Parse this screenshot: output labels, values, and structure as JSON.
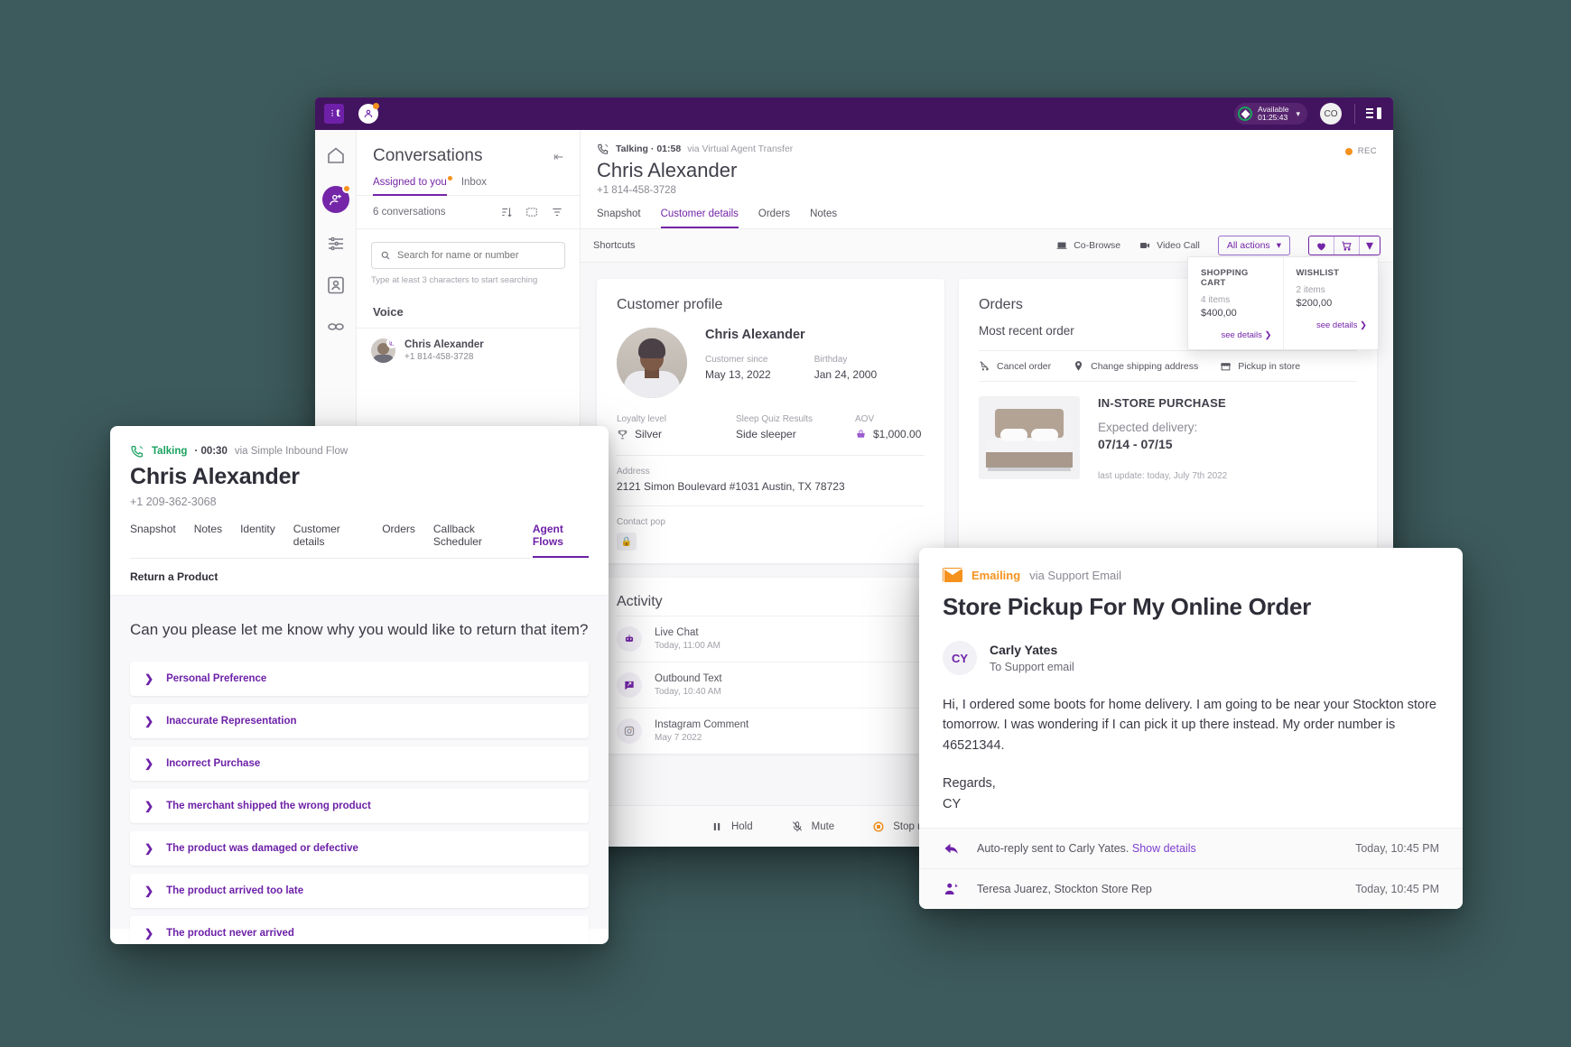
{
  "app": {
    "logo_letter": "t",
    "status": {
      "label": "Available",
      "timer": "01:25:43"
    },
    "user_initials": "CO"
  },
  "conversations": {
    "title": "Conversations",
    "tabs": [
      {
        "label": "Assigned to you",
        "active": true,
        "dot": true
      },
      {
        "label": "Inbox",
        "active": false,
        "dot": false
      }
    ],
    "count_label": "6 conversations",
    "search": {
      "placeholder": "Search for name or number",
      "value": ""
    },
    "search_hint": "Type at least 3 characters to start searching",
    "section_label": "Voice",
    "items": [
      {
        "name": "Chris Alexander",
        "number": "+1 814-458-3728"
      }
    ]
  },
  "main": {
    "status_label": "Talking",
    "duration": "01:58",
    "via": "via Virtual Agent Transfer",
    "customer_name": "Chris Alexander",
    "customer_number": "+1 814-458-3728",
    "rec_label": "REC",
    "tabs": [
      {
        "label": "Snapshot",
        "active": false
      },
      {
        "label": "Customer details",
        "active": true
      },
      {
        "label": "Orders",
        "active": false
      },
      {
        "label": "Notes",
        "active": false
      }
    ],
    "shortcuts_label": "Shortcuts",
    "shortcut_actions": [
      {
        "label": "Co-Browse",
        "icon": "co-browse-icon"
      },
      {
        "label": "Video Call",
        "icon": "video-call-icon"
      }
    ],
    "all_actions_label": "All actions",
    "cart_dropdown": [
      {
        "title": "SHOPPING CART",
        "items": "4 items",
        "amount": "$400,00",
        "link": "see details"
      },
      {
        "title": "WISHLIST",
        "items": "2 items",
        "amount": "$200,00",
        "link": "see details"
      }
    ]
  },
  "profile": {
    "card_title": "Customer profile",
    "name": "Chris Alexander",
    "fields": [
      {
        "label": "Customer since",
        "value": "May 13, 2022"
      },
      {
        "label": "Birthday",
        "value": "Jan 24, 2000"
      },
      {
        "label": "Loyalty level",
        "value": "Silver",
        "icon": "trophy-icon"
      },
      {
        "label": "Sleep Quiz Results",
        "value": "Side sleeper"
      },
      {
        "label": "AOV",
        "value": "$1,000.00",
        "icon": "basket-icon"
      }
    ],
    "address_label": "Address",
    "address": "2121 Simon Boulevard #1031 Austin, TX 78723",
    "contact_label": "Contact pop"
  },
  "orders": {
    "card_title": "Orders",
    "sub_title": "Most recent order",
    "actions": [
      {
        "label": "Cancel order",
        "icon": "cancel-cart-icon"
      },
      {
        "label": "Change shipping address",
        "icon": "location-pin-icon"
      },
      {
        "label": "Pickup in store",
        "icon": "store-icon"
      }
    ],
    "kind": "IN-STORE PURCHASE",
    "expected_label": "Expected delivery:",
    "expected_value": "07/14 - 07/15",
    "last_update": "last update: today, July 7th 2022"
  },
  "activity": {
    "card_title": "Activity",
    "items": [
      {
        "title": "Live Chat",
        "time": "Today, 11:00 AM",
        "icon": "chat-bot-icon"
      },
      {
        "title": "Outbound Text",
        "time": "Today, 10:40 AM",
        "icon": "outbound-message-icon"
      },
      {
        "title": "Instagram Comment",
        "time": "May 7 2022",
        "icon": "instagram-icon"
      }
    ]
  },
  "callbar": [
    {
      "label": "Hold",
      "icon": "pause-icon"
    },
    {
      "label": "Mute",
      "icon": "mic-off-icon"
    },
    {
      "label": "Stop recording",
      "icon": "stop-recording-icon"
    }
  ],
  "agent_flow": {
    "status_label": "Talking",
    "duration": "00:30",
    "via": "via Simple Inbound Flow",
    "customer_name": "Chris Alexander",
    "customer_number": "+1 209-362-3068",
    "tabs": [
      {
        "label": "Snapshot",
        "active": false
      },
      {
        "label": "Notes",
        "active": false
      },
      {
        "label": "Identity",
        "active": false
      },
      {
        "label": "Customer details",
        "active": false
      },
      {
        "label": "Orders",
        "active": false
      },
      {
        "label": "Callback Scheduler",
        "active": false
      },
      {
        "label": "Agent Flows",
        "active": true
      }
    ],
    "flow_name": "Return a Product",
    "question": "Can you please let me know why you would like to return that item?",
    "options": [
      "Personal Preference",
      "Inaccurate Representation",
      "Incorrect Purchase",
      "The merchant shipped the wrong product",
      "The product was damaged or defective",
      "The product arrived too late",
      "The product never arrived"
    ]
  },
  "email": {
    "status_label": "Emailing",
    "via": "via Support Email",
    "subject": "Store Pickup For My Online Order",
    "sender_initials": "CY",
    "sender_name": "Carly Yates",
    "sender_to": "To Support email",
    "body": "Hi,  I ordered some boots for home delivery. I am going to be near your Stockton store tomorrow. I was wondering if I can pick it up there instead. My order number is 46521344.",
    "sign_off": "Regards,",
    "sign_name": "CY",
    "footer": [
      {
        "text": "Auto-reply sent to Carly Yates.",
        "link": "Show details",
        "time": "Today, 10:45 PM",
        "icon": "reply-icon"
      },
      {
        "text": "Teresa Juarez, Stockton Store Rep",
        "link": "",
        "time": "Today, 10:45 PM",
        "icon": "agent-assign-icon"
      }
    ]
  }
}
